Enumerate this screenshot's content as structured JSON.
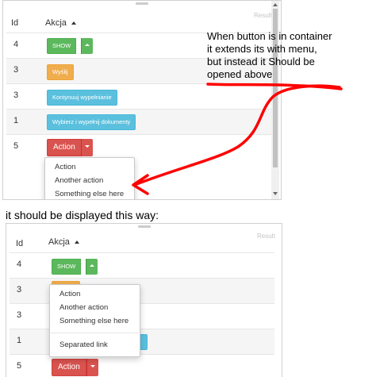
{
  "top": {
    "result_label": "Result",
    "col_id": "Id",
    "col_action": "Akcja",
    "rows": [
      {
        "id": "4",
        "button": "SHOW"
      },
      {
        "id": "3",
        "button": "Wyślij"
      },
      {
        "id": "3",
        "button": "Kontynuuj wypełnianie"
      },
      {
        "id": "1",
        "button": "Wybierz i wypełnij dokumenty"
      },
      {
        "id": "5",
        "button": "Action"
      }
    ],
    "menu": [
      "Action",
      "Another action",
      "Something else here"
    ]
  },
  "bottom": {
    "result_label": "Result",
    "col_id": "Id",
    "col_action": "Akcja",
    "rows": [
      {
        "id": "4",
        "button": "SHOW"
      },
      {
        "id": "3"
      },
      {
        "id": "3"
      },
      {
        "id": "1"
      },
      {
        "id": "5",
        "button": "Action"
      }
    ],
    "menu": [
      "Action",
      "Another action",
      "Something else here",
      "Separated link"
    ]
  },
  "annotation": {
    "lines": [
      "When button is in container",
      "it extends its with menu,",
      "but instead it Should be",
      "opened above"
    ]
  },
  "caption": "it should be displayed this way:",
  "colors": {
    "green": "#5cb85c",
    "orange": "#f0ad4e",
    "blue": "#5bc0de",
    "red": "#d9534f",
    "annotation_red": "#ff0000"
  }
}
